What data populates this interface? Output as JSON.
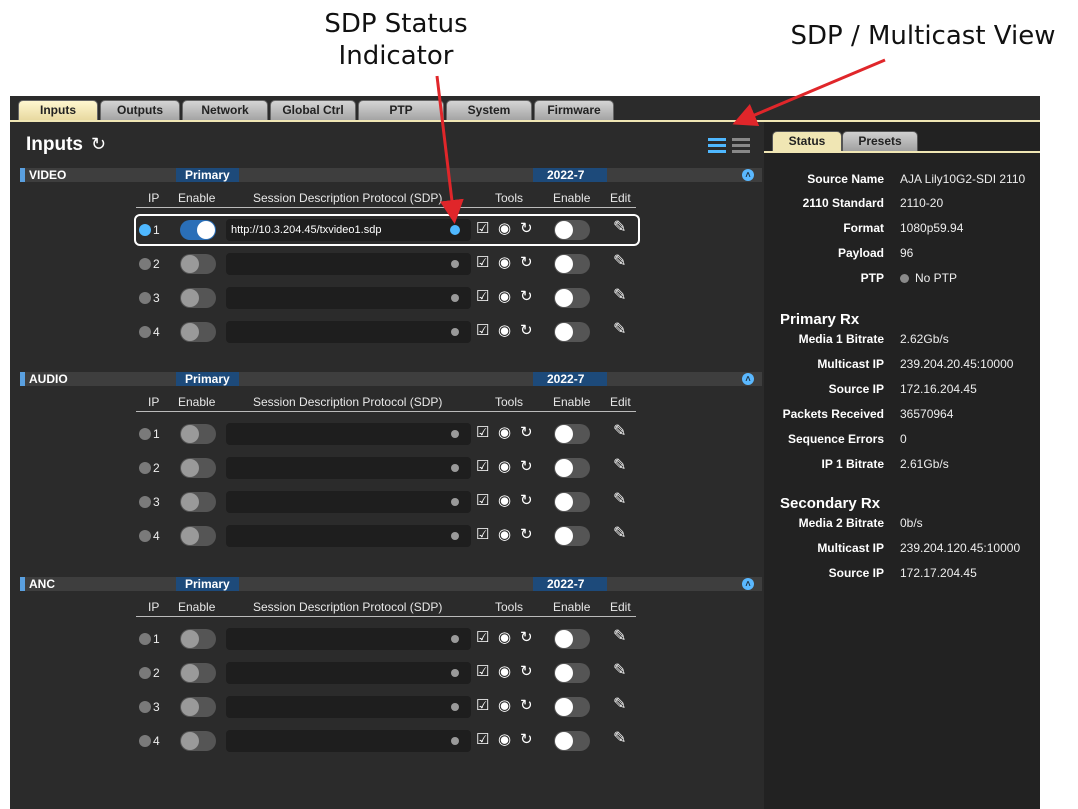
{
  "callouts": {
    "sdp_status": [
      "SDP Status",
      "Indicator"
    ],
    "view": "SDP / Multicast View"
  },
  "tabs": [
    "Inputs",
    "Outputs",
    "Network",
    "Global Ctrl",
    "PTP",
    "System",
    "Firmware"
  ],
  "active_tab": "Inputs",
  "page_title": "Inputs",
  "icons": {
    "refresh": "refresh-icon",
    "list_view": "list-view-icon",
    "grid_view": "grid-view-icon"
  },
  "columns": {
    "ip": "IP",
    "enable": "Enable",
    "sdp": "Session Description Protocol (SDP)",
    "tools": "Tools",
    "enable2": "Enable",
    "edit": "Edit"
  },
  "sections": [
    {
      "name": "VIDEO",
      "primary": "Primary",
      "secondary": "2022-7",
      "rows": [
        {
          "ip": "1",
          "enabled": true,
          "sdp": "http://10.3.204.45/txvideo1.sdp",
          "sdp_ok": true
        },
        {
          "ip": "2",
          "enabled": false,
          "sdp": "",
          "sdp_ok": false
        },
        {
          "ip": "3",
          "enabled": false,
          "sdp": "",
          "sdp_ok": false
        },
        {
          "ip": "4",
          "enabled": false,
          "sdp": "",
          "sdp_ok": false
        }
      ]
    },
    {
      "name": "AUDIO",
      "primary": "Primary",
      "secondary": "2022-7",
      "rows": [
        {
          "ip": "1",
          "enabled": false,
          "sdp": "",
          "sdp_ok": false
        },
        {
          "ip": "2",
          "enabled": false,
          "sdp": "",
          "sdp_ok": false
        },
        {
          "ip": "3",
          "enabled": false,
          "sdp": "",
          "sdp_ok": false
        },
        {
          "ip": "4",
          "enabled": false,
          "sdp": "",
          "sdp_ok": false
        }
      ]
    },
    {
      "name": "ANC",
      "primary": "Primary",
      "secondary": "2022-7",
      "rows": [
        {
          "ip": "1",
          "enabled": false,
          "sdp": "",
          "sdp_ok": false
        },
        {
          "ip": "2",
          "enabled": false,
          "sdp": "",
          "sdp_ok": false
        },
        {
          "ip": "3",
          "enabled": false,
          "sdp": "",
          "sdp_ok": false
        },
        {
          "ip": "4",
          "enabled": false,
          "sdp": "",
          "sdp_ok": false
        }
      ]
    }
  ],
  "right_tabs": [
    "Status",
    "Presets"
  ],
  "status": {
    "source_name": {
      "label": "Source Name",
      "value": "AJA Lily10G2-SDI 2110"
    },
    "standard": {
      "label": "2110 Standard",
      "value": "2110-20"
    },
    "format": {
      "label": "Format",
      "value": "1080p59.94"
    },
    "payload": {
      "label": "Payload",
      "value": "96"
    },
    "ptp": {
      "label": "PTP",
      "value": "No PTP"
    }
  },
  "primary_rx": {
    "title": "Primary Rx",
    "items": [
      {
        "label": "Media 1 Bitrate",
        "value": "2.62Gb/s"
      },
      {
        "label": "Multicast IP",
        "value": "239.204.20.45:10000"
      },
      {
        "label": "Source IP",
        "value": "172.16.204.45"
      },
      {
        "label": "Packets Received",
        "value": "36570964"
      },
      {
        "label": "Sequence Errors",
        "value": "0"
      },
      {
        "label": "IP 1 Bitrate",
        "value": "2.61Gb/s"
      }
    ]
  },
  "secondary_rx": {
    "title": "Secondary Rx",
    "items": [
      {
        "label": "Media 2 Bitrate",
        "value": "0b/s"
      },
      {
        "label": "Multicast IP",
        "value": "239.204.120.45:10000"
      },
      {
        "label": "Source IP",
        "value": "172.17.204.45"
      }
    ]
  },
  "colors": {
    "accent": "#4fb8ff",
    "tab_active": "#f0e6b4",
    "panel": "#2b2b2b",
    "arrow": "#e0262a"
  }
}
